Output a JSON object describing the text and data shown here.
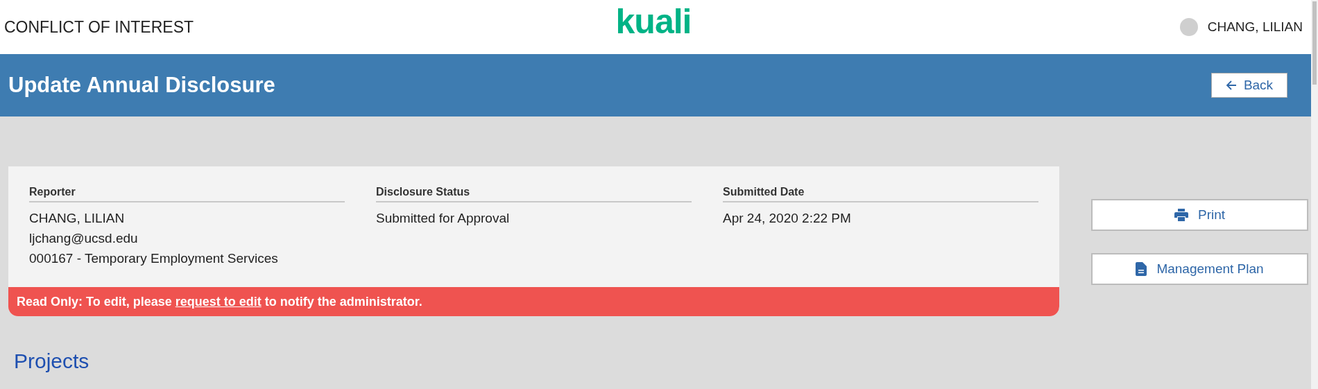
{
  "header": {
    "app_title": "CONFLICT OF INTEREST",
    "logo": "kuali",
    "user": "CHANG, LILIAN"
  },
  "title_bar": {
    "title": "Update Annual Disclosure",
    "back_button": "Back"
  },
  "disclosure": {
    "columns": [
      {
        "heading": "Reporter",
        "lines": [
          "CHANG, LILIAN",
          "ljchang@ucsd.edu",
          "000167 - Temporary Employment Services"
        ]
      },
      {
        "heading": "Disclosure Status",
        "lines": [
          "Submitted for Approval"
        ]
      },
      {
        "heading": "Submitted Date",
        "lines": [
          "Apr 24, 2020 2:22 PM"
        ]
      }
    ],
    "notice": {
      "before": "Read Only: To edit, please ",
      "link": "request to edit",
      "after": " to notify the administrator."
    }
  },
  "actions": [
    {
      "kind": "print",
      "label": "Print"
    },
    {
      "kind": "document",
      "label": "Management Plan"
    }
  ],
  "section_heading": "Projects"
}
